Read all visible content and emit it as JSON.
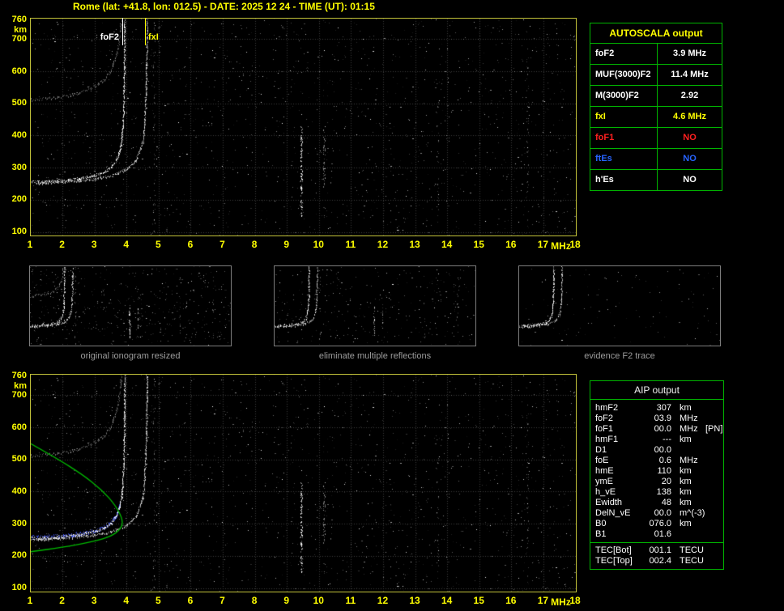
{
  "header": {
    "title": "Rome (lat: +41.8, lon: 012.5) - DATE: 2025 12 24 - TIME (UT): 01:15"
  },
  "autoscala_table": {
    "title": "AUTOSCALA output",
    "rows": [
      {
        "label": "foF2",
        "value": "3.9 MHz",
        "color": "#ffffff"
      },
      {
        "label": "MUF(3000)F2",
        "value": "11.4 MHz",
        "color": "#ffffff"
      },
      {
        "label": "M(3000)F2",
        "value": "2.92",
        "color": "#ffffff"
      },
      {
        "label": "fxI",
        "value": "4.6 MHz",
        "color": "#ffff00"
      },
      {
        "label": "foF1",
        "value": "NO",
        "color": "#ff2020"
      },
      {
        "label": "ftEs",
        "value": "NO",
        "color": "#2864ff"
      },
      {
        "label": "h'Es",
        "value": "NO",
        "color": "#ffffff"
      }
    ]
  },
  "thumbnails": [
    {
      "caption": "original ionogram resized"
    },
    {
      "caption": "eliminate multiple reflections"
    },
    {
      "caption": "evidence F2 trace"
    }
  ],
  "aip_table": {
    "title": "AIP output",
    "rows": [
      {
        "name": "hmF2",
        "value": "307",
        "unit": "km",
        "extra": ""
      },
      {
        "name": "foF2",
        "value": "03.9",
        "unit": "MHz",
        "extra": ""
      },
      {
        "name": "foF1",
        "value": "00.0",
        "unit": "MHz",
        "extra": "[PN]"
      },
      {
        "name": "hmF1",
        "value": "---",
        "unit": "km",
        "extra": ""
      },
      {
        "name": "D1",
        "value": "00.0",
        "unit": "",
        "extra": ""
      },
      {
        "name": "foE",
        "value": "0.6",
        "unit": "MHz",
        "extra": ""
      },
      {
        "name": "hmE",
        "value": "110",
        "unit": "km",
        "extra": ""
      },
      {
        "name": "ymE",
        "value": "20",
        "unit": "km",
        "extra": ""
      },
      {
        "name": "h_vE",
        "value": "138",
        "unit": "km",
        "extra": ""
      },
      {
        "name": "Ewidth",
        "value": "48",
        "unit": "km",
        "extra": ""
      },
      {
        "name": "DelN_vE",
        "value": "00.0",
        "unit": "m^(-3)",
        "extra": ""
      },
      {
        "name": "B0",
        "value": "076.0",
        "unit": "km",
        "extra": ""
      },
      {
        "name": "B1",
        "value": "01.6",
        "unit": "",
        "extra": ""
      }
    ],
    "tec_rows": [
      {
        "name": "TEC[Bot]",
        "value": "001.1",
        "unit": "TECU",
        "extra": ""
      },
      {
        "name": "TEC[Top]",
        "value": "002.4",
        "unit": "TECU",
        "extra": ""
      }
    ]
  },
  "chart_data": [
    {
      "id": "main-ionogram",
      "type": "scatter",
      "title": "Rome ionogram - 2025 12 24 - 01:15 UT",
      "xlabel": "MHz",
      "ylabel": "km",
      "xlim": [
        1,
        18
      ],
      "ylim": [
        90,
        765
      ],
      "x_ticks": [
        1,
        2,
        3,
        4,
        5,
        6,
        7,
        8,
        9,
        10,
        11,
        12,
        13,
        14,
        15,
        16,
        17,
        18
      ],
      "y_ticks": [
        760,
        700,
        600,
        500,
        400,
        300,
        200,
        100
      ],
      "grid": true,
      "markers": {
        "foF2": {
          "label": "foF2",
          "mhz": 3.9
        },
        "fxI": {
          "label": "fxI",
          "mhz": 4.6
        }
      },
      "o_trace_f_h": [
        [
          1.0,
          256
        ],
        [
          1.5,
          258
        ],
        [
          2.0,
          261
        ],
        [
          2.5,
          267
        ],
        [
          3.0,
          277
        ],
        [
          3.3,
          288
        ],
        [
          3.5,
          301
        ],
        [
          3.7,
          329
        ],
        [
          3.8,
          361
        ],
        [
          3.85,
          394
        ],
        [
          3.9,
          468
        ],
        [
          3.93,
          615
        ],
        [
          3.94,
          760
        ]
      ],
      "x_trace_f_h": [
        [
          1.2,
          252
        ],
        [
          2.0,
          256
        ],
        [
          2.5,
          260
        ],
        [
          3.0,
          266
        ],
        [
          3.5,
          276
        ],
        [
          4.0,
          295
        ],
        [
          4.3,
          325
        ],
        [
          4.5,
          380
        ],
        [
          4.55,
          430
        ],
        [
          4.6,
          530
        ],
        [
          4.63,
          680
        ],
        [
          4.64,
          760
        ]
      ],
      "rfi_streaks_MHz": [
        4.85,
        9.45,
        10.15,
        13.7,
        16.5
      ]
    },
    {
      "id": "aip-ionogram",
      "type": "scatter",
      "title": "AIP restored trace and electron density profile",
      "xlabel": "MHz",
      "ylabel": "km",
      "xlim": [
        1,
        18
      ],
      "ylim": [
        90,
        765
      ],
      "x_ticks": [
        1,
        2,
        3,
        4,
        5,
        6,
        7,
        8,
        9,
        10,
        11,
        12,
        13,
        14,
        15,
        16,
        17,
        18
      ],
      "y_ticks": [
        760,
        700,
        600,
        500,
        400,
        300,
        200,
        100
      ],
      "grid": true,
      "profile_f_h_green": [
        [
          1.0,
          550
        ],
        [
          1.8,
          505
        ],
        [
          2.6,
          455
        ],
        [
          3.2,
          408
        ],
        [
          3.65,
          358
        ],
        [
          3.9,
          307
        ],
        [
          3.75,
          278
        ],
        [
          3.4,
          258
        ],
        [
          2.8,
          242
        ],
        [
          2.0,
          228
        ],
        [
          1.0,
          214
        ]
      ],
      "restored_trace_f_h_blue": [
        [
          1.0,
          258
        ],
        [
          1.5,
          260
        ],
        [
          2.0,
          263
        ],
        [
          2.5,
          269
        ],
        [
          3.0,
          279
        ],
        [
          3.3,
          290
        ],
        [
          3.5,
          303
        ],
        [
          3.7,
          331
        ],
        [
          3.8,
          363
        ]
      ]
    }
  ]
}
